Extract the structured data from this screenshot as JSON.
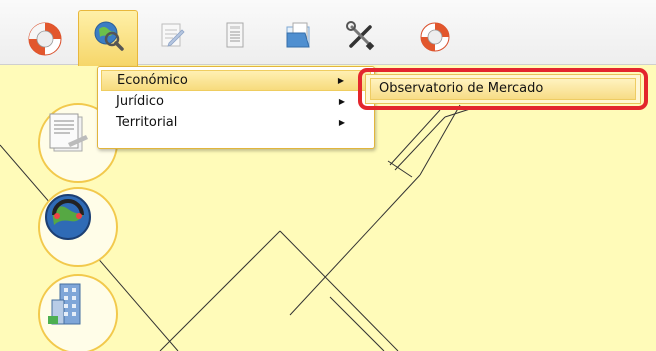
{
  "toolbar": {
    "buttons": [
      {
        "icon": "lifebuoy-icon",
        "active": false
      },
      {
        "icon": "globe-search-icon",
        "active": true
      },
      {
        "icon": "edit-document-icon",
        "active": false
      },
      {
        "icon": "list-document-icon",
        "active": false
      },
      {
        "icon": "folder-open-icon",
        "active": false
      },
      {
        "icon": "tools-icon",
        "active": false
      },
      {
        "icon": "lifebuoy-icon",
        "active": false
      }
    ]
  },
  "menu": {
    "items": [
      {
        "label": "Económico",
        "selected": true
      },
      {
        "label": "Jurídico",
        "selected": false
      },
      {
        "label": "Territorial",
        "selected": false
      }
    ],
    "arrow": "▶"
  },
  "submenu": {
    "items": [
      {
        "label": "Observatorio de Mercado",
        "selected": true
      }
    ],
    "highlight_color": "#e3262d"
  },
  "side_buttons": [
    {
      "icon": "document-stack-icon"
    },
    {
      "icon": "earth-gauge-icon"
    },
    {
      "icon": "building-icon"
    }
  ],
  "colors": {
    "map_background": "#fffbb9",
    "accent": "#f2c94c"
  }
}
